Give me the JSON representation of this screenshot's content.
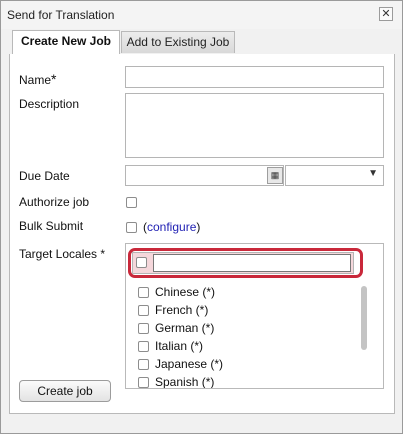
{
  "dialog": {
    "title": "Send for Translation",
    "close_glyph": "✕"
  },
  "tabs": [
    {
      "label": "Create New Job",
      "active": true
    },
    {
      "label": "Add to Existing Job",
      "active": false
    }
  ],
  "form": {
    "name_label": "Name",
    "required_marker": "*",
    "name_value": "",
    "description_label": "Description",
    "description_value": "",
    "due_date_label": "Due Date",
    "due_date_value": "",
    "due_time_value": "",
    "authorize_label": "Authorize job",
    "authorize_checked": false,
    "bulk_submit_label": "Bulk Submit",
    "bulk_submit_checked": false,
    "configure_prefix": "(",
    "configure_link": "configure",
    "configure_suffix": ")",
    "target_locales_label": "Target Locales *",
    "locale_filter_value": "",
    "locales": [
      {
        "label": "Chinese (*)",
        "checked": false
      },
      {
        "label": "French (*)",
        "checked": false
      },
      {
        "label": "German (*)",
        "checked": false
      },
      {
        "label": "Italian (*)",
        "checked": false
      },
      {
        "label": "Japanese (*)",
        "checked": false
      },
      {
        "label": "Spanish (*)",
        "checked": false
      }
    ]
  },
  "actions": {
    "create_job_label": "Create job"
  },
  "icons": {
    "calendar": "calendar-icon",
    "dropdown": "chevron-down-icon",
    "close": "close-icon"
  },
  "colors": {
    "highlight_border": "#c9283a",
    "filter_background": "#f5d7db",
    "link": "#1f1fb3"
  }
}
